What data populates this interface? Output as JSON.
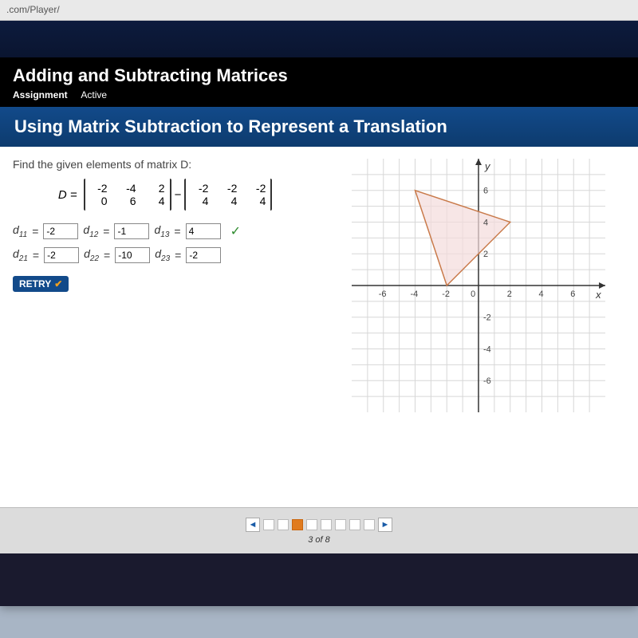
{
  "url": ".com/Player/",
  "lesson": {
    "title": "Adding and Subtracting Matrices",
    "sub_bold": "Assignment",
    "sub_status": "Active"
  },
  "section_title": "Using Matrix Subtraction to Represent a Translation",
  "prompt": "Find the given elements of matrix D:",
  "matrix": {
    "label": "D =",
    "minus": "−",
    "a": {
      "r1": [
        "-2",
        "-4",
        "2"
      ],
      "r2": [
        "0",
        "6",
        "4"
      ]
    },
    "b": {
      "r1": [
        "-2",
        "-2",
        "-2"
      ],
      "r2": [
        "4",
        "4",
        "4"
      ]
    }
  },
  "answers": {
    "row1": [
      {
        "label": "d",
        "sub": "11",
        "eq": "=",
        "val": "-2"
      },
      {
        "label": "d",
        "sub": "12",
        "eq": "=",
        "val": "-1"
      },
      {
        "label": "d",
        "sub": "13",
        "eq": "=",
        "val": "4"
      }
    ],
    "row2": [
      {
        "label": "d",
        "sub": "21",
        "eq": "=",
        "val": "-2"
      },
      {
        "label": "d",
        "sub": "22",
        "eq": "=",
        "val": "-10"
      },
      {
        "label": "d",
        "sub": "23",
        "eq": "=",
        "val": "-2"
      }
    ],
    "row1_mark": "✓",
    "row2_mark": ""
  },
  "retry": "RETRY",
  "graph": {
    "y_label": "y",
    "x_label": "x",
    "ticks_x": [
      "-6",
      "-4",
      "-2",
      "0",
      "2",
      "4",
      "6"
    ],
    "ticks_y": [
      "6",
      "4",
      "2",
      "-2",
      "-4",
      "-6"
    ]
  },
  "pager": {
    "total": 8,
    "current": 3,
    "label": "3 of 8",
    "prev": "◄",
    "next": "►"
  }
}
